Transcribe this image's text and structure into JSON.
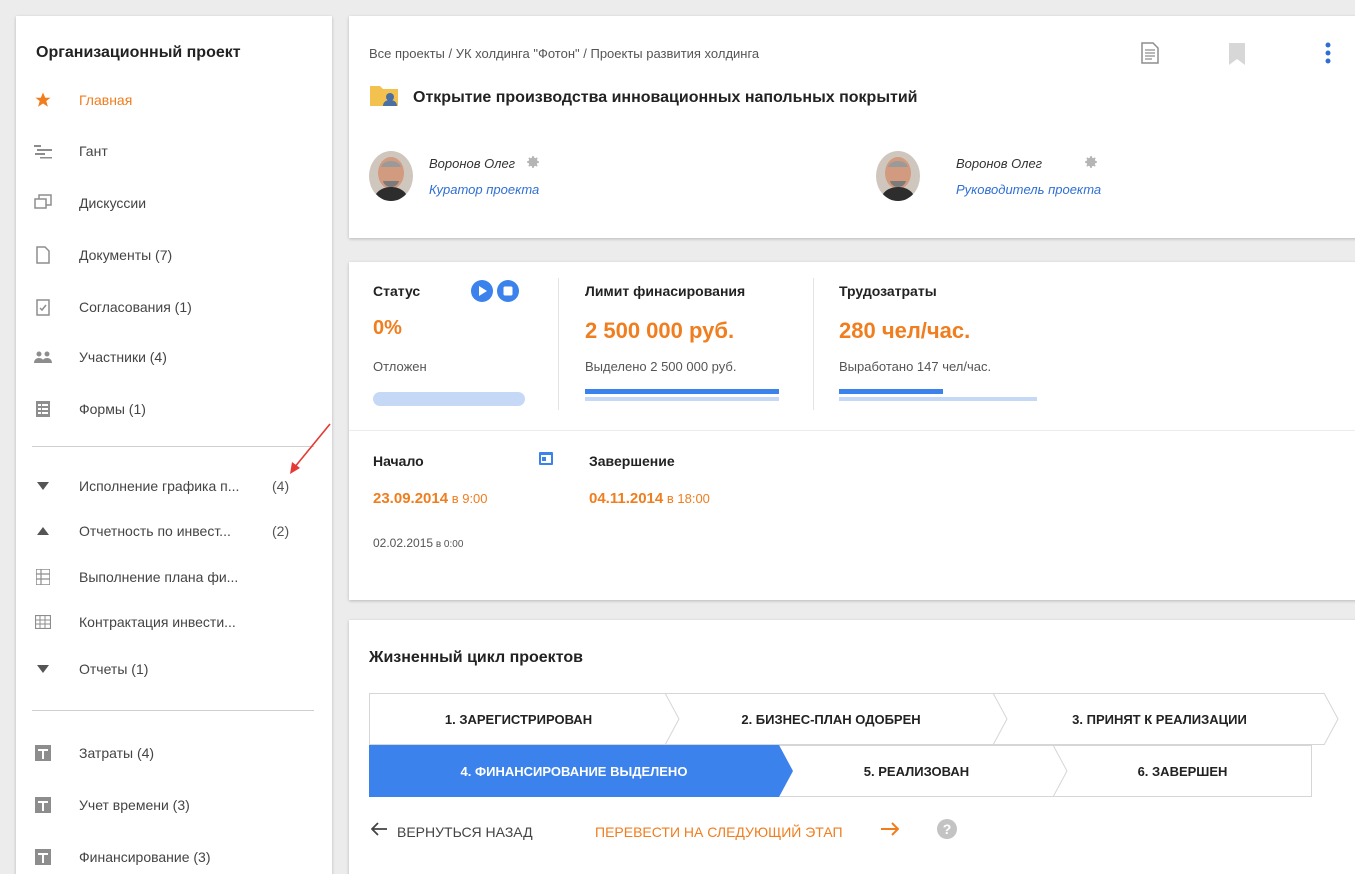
{
  "sidebar": {
    "title": "Организационный проект",
    "items": [
      {
        "label": "Главная",
        "icon": "star-icon"
      },
      {
        "label": "Гант",
        "icon": "gantt-icon"
      },
      {
        "label": "Дискуссии",
        "icon": "discussions-icon"
      },
      {
        "label": "Документы (7)",
        "icon": "document-icon"
      },
      {
        "label": "Согласования (1)",
        "icon": "approval-icon"
      },
      {
        "label": "Участники (4)",
        "icon": "people-icon"
      },
      {
        "label": "Формы (1)",
        "icon": "form-icon"
      }
    ],
    "groups": [
      {
        "label": "Исполнение графика п...",
        "count": "(4)",
        "icon": "triangle-down-icon"
      },
      {
        "label": "Отчетность по инвест...",
        "count": "(2)",
        "icon": "triangle-up-icon"
      },
      {
        "label": "Выполнение плана фи...",
        "icon": "grid-report-icon"
      },
      {
        "label": "Контрактация инвести...",
        "icon": "table-icon"
      },
      {
        "label": "Отчеты (1)",
        "icon": "triangle-down-icon"
      }
    ],
    "extras": [
      {
        "label": "Затраты (4)",
        "icon": "plus-box-icon"
      },
      {
        "label": "Учет времени (3)",
        "icon": "plus-box-icon"
      },
      {
        "label": "Финансирование (3)",
        "icon": "plus-box-icon"
      }
    ]
  },
  "header": {
    "breadcrumb": "Все проекты / УК холдинга \"Фотон\" / Проекты развития холдинга",
    "title": "Открытие производства инновационных напольных покрытий",
    "people": [
      {
        "name": "Воронов Олег",
        "role": "Куратор проекта"
      },
      {
        "name": "Воронов Олег",
        "role": "Руководитель проекта"
      }
    ]
  },
  "stats": {
    "status": {
      "label": "Статус",
      "value": "0%",
      "text": "Отложен"
    },
    "funding": {
      "label": "Лимит финасирования",
      "value": "2 500 000 руб.",
      "sub": "Выделено  2 500 000 руб.",
      "progress": 1.0
    },
    "labor": {
      "label": "Трудозатраты",
      "value": "280 чел/час.",
      "sub": "Выработано  147 чел/час.",
      "progress": 0.525
    },
    "start": {
      "label": "Начало",
      "date": "23.09.2014",
      "time": " в 9:00",
      "actual": "02.02.2015",
      "actual_time": " в 0:00"
    },
    "end": {
      "label": "Завершение",
      "date": "04.11.2014",
      "time": " в 18:00"
    }
  },
  "lifecycle": {
    "title": "Жизненный цикл проектов",
    "stages": [
      "1. ЗАРЕГИСТРИРОВАН",
      "2. БИЗНЕС-ПЛАН ОДОБРЕН",
      "3. ПРИНЯТ К РЕАЛИЗАЦИИ",
      "4. ФИНАНСИРОВАНИЕ ВЫДЕЛЕНО",
      "5. РЕАЛИЗОВАН",
      "6. ЗАВЕРШЕН"
    ],
    "active_stage": 4,
    "back_label": "ВЕРНУТЬСЯ НАЗАД",
    "next_label": "ПЕРЕВЕСТИ НА СЛЕДУЮЩИЙ ЭТАП"
  },
  "colors": {
    "accent": "#f07d1e",
    "primary": "#3b82ec",
    "link": "#2f6fd3"
  }
}
